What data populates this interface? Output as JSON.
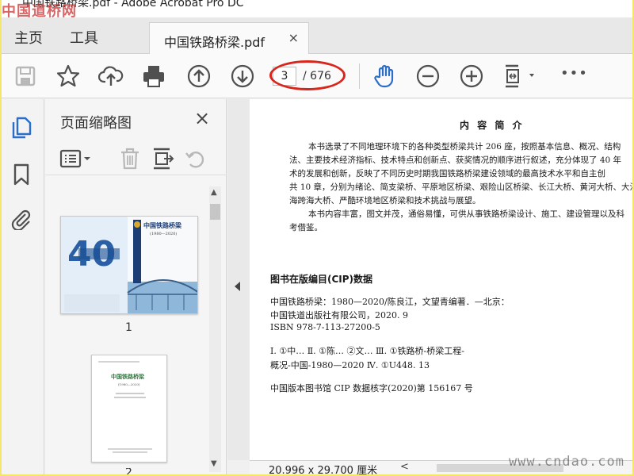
{
  "window": {
    "title": "中国铁路桥梁.pdf - Adobe Acrobat Pro DC",
    "watermark_top": "中国道桥网",
    "watermark_bottom": "www.cndao.com"
  },
  "nav": {
    "home": "主页",
    "tools": "工具",
    "doc_tab": "中国铁路桥梁.pdf",
    "doc_tab_close": "×"
  },
  "toolbar": {
    "page_current": "3",
    "page_total": "/ 676",
    "more": "•••",
    "icons": [
      "save-icon",
      "bookmark-star-icon",
      "upload-cloud-icon",
      "print-icon",
      "page-up-icon",
      "page-down-icon",
      "hand-tool-icon",
      "zoom-out-icon",
      "zoom-in-icon",
      "fit-page-icon",
      "more-icon"
    ],
    "accent": "#2a6ec8",
    "highlight": "#d8261c"
  },
  "panel": {
    "title": "页面缩略图",
    "close": "×",
    "page1_label": "1",
    "page2_label": "2"
  },
  "thumb1": {
    "title": "中国铁路桥梁",
    "subtitle": "(1980—2020)"
  },
  "thumb2": {
    "title": "中国铁路桥梁",
    "subtitle": "(1980—2020)"
  },
  "page": {
    "heading": "内 容 简 介",
    "para_lines": [
      "本书选录了不同地理环境下的各种类型桥梁共计 206 座，按照基本信息、概况、结构",
      "法、主要技术经济指标、技术特点和创新点、获奖情况的顺序进行叙述，充分体现了 40 年",
      "术的发展和创新，反映了不同历史时期我国铁路桥梁建设领域的最高技术水平和自主创",
      "共 10 章，分别为绪论、简支梁桥、平原地区桥梁、艰险山区桥梁、长江大桥、黄河大桥、大江",
      "海跨海大桥、严酷环境地区桥梁和技术挑战与展望。",
      "本书内容丰富，图文并茂，通俗易懂，可供从事铁路桥梁设计、施工、建设管理以及科",
      "考借鉴。"
    ],
    "cip_title": "图书在版编目(CIP)数据",
    "cip_lines": [
      "中国铁路桥梁：1980—2020/陈良江，文望青编著．—北京：",
      "中国铁道出版社有限公司，2020. 9",
      "ISBN 978-7-113-27200-5",
      "Ⅰ. ①中…  Ⅱ. ①陈…  ②文…  Ⅲ. ①铁路桥-桥梁工程-",
      "概况-中国-1980—2020  Ⅳ. ①U448. 13",
      "中国版本图书馆 CIP 数据核字(2020)第 156167 号"
    ]
  },
  "status": {
    "page_size": "20.996 x 29.700 厘米",
    "scroll_left": "<"
  }
}
